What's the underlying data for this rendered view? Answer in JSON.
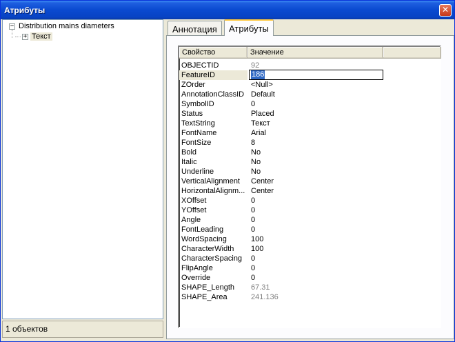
{
  "window": {
    "title": "Атрибуты",
    "close_glyph": "✕"
  },
  "tree": {
    "root": {
      "label": "Distribution mains diameters",
      "expander": "−"
    },
    "child": {
      "label": "Текст",
      "expander": "+"
    }
  },
  "status": {
    "text": "1 объектов"
  },
  "tabs": [
    {
      "label": "Аннотация",
      "active": false
    },
    {
      "label": "Атрибуты",
      "active": true
    }
  ],
  "grid": {
    "columns": [
      "Свойство",
      "Значение"
    ],
    "rows": [
      {
        "prop": "OBJECTID",
        "value": "92",
        "readonly": true
      },
      {
        "prop": "FeatureID",
        "value": "186",
        "editing": true
      },
      {
        "prop": "ZOrder",
        "value": "<Null>"
      },
      {
        "prop": "AnnotationClassID",
        "value": "Default"
      },
      {
        "prop": "SymbolID",
        "value": "0"
      },
      {
        "prop": "Status",
        "value": "Placed"
      },
      {
        "prop": "TextString",
        "value": "Текст"
      },
      {
        "prop": "FontName",
        "value": "Arial"
      },
      {
        "prop": "FontSize",
        "value": "8"
      },
      {
        "prop": "Bold",
        "value": "No"
      },
      {
        "prop": "Italic",
        "value": "No"
      },
      {
        "prop": "Underline",
        "value": "No"
      },
      {
        "prop": "VerticalAlignment",
        "value": "Center"
      },
      {
        "prop": "HorizontalAlignm...",
        "value": "Center"
      },
      {
        "prop": "XOffset",
        "value": "0"
      },
      {
        "prop": "YOffset",
        "value": "0"
      },
      {
        "prop": "Angle",
        "value": "0"
      },
      {
        "prop": "FontLeading",
        "value": "0"
      },
      {
        "prop": "WordSpacing",
        "value": "100"
      },
      {
        "prop": "CharacterWidth",
        "value": "100"
      },
      {
        "prop": "CharacterSpacing",
        "value": "0"
      },
      {
        "prop": "FlipAngle",
        "value": "0"
      },
      {
        "prop": "Override",
        "value": "0"
      },
      {
        "prop": "SHAPE_Length",
        "value": "67.31",
        "readonly": true
      },
      {
        "prop": "SHAPE_Area",
        "value": "241.136",
        "readonly": true
      }
    ]
  }
}
